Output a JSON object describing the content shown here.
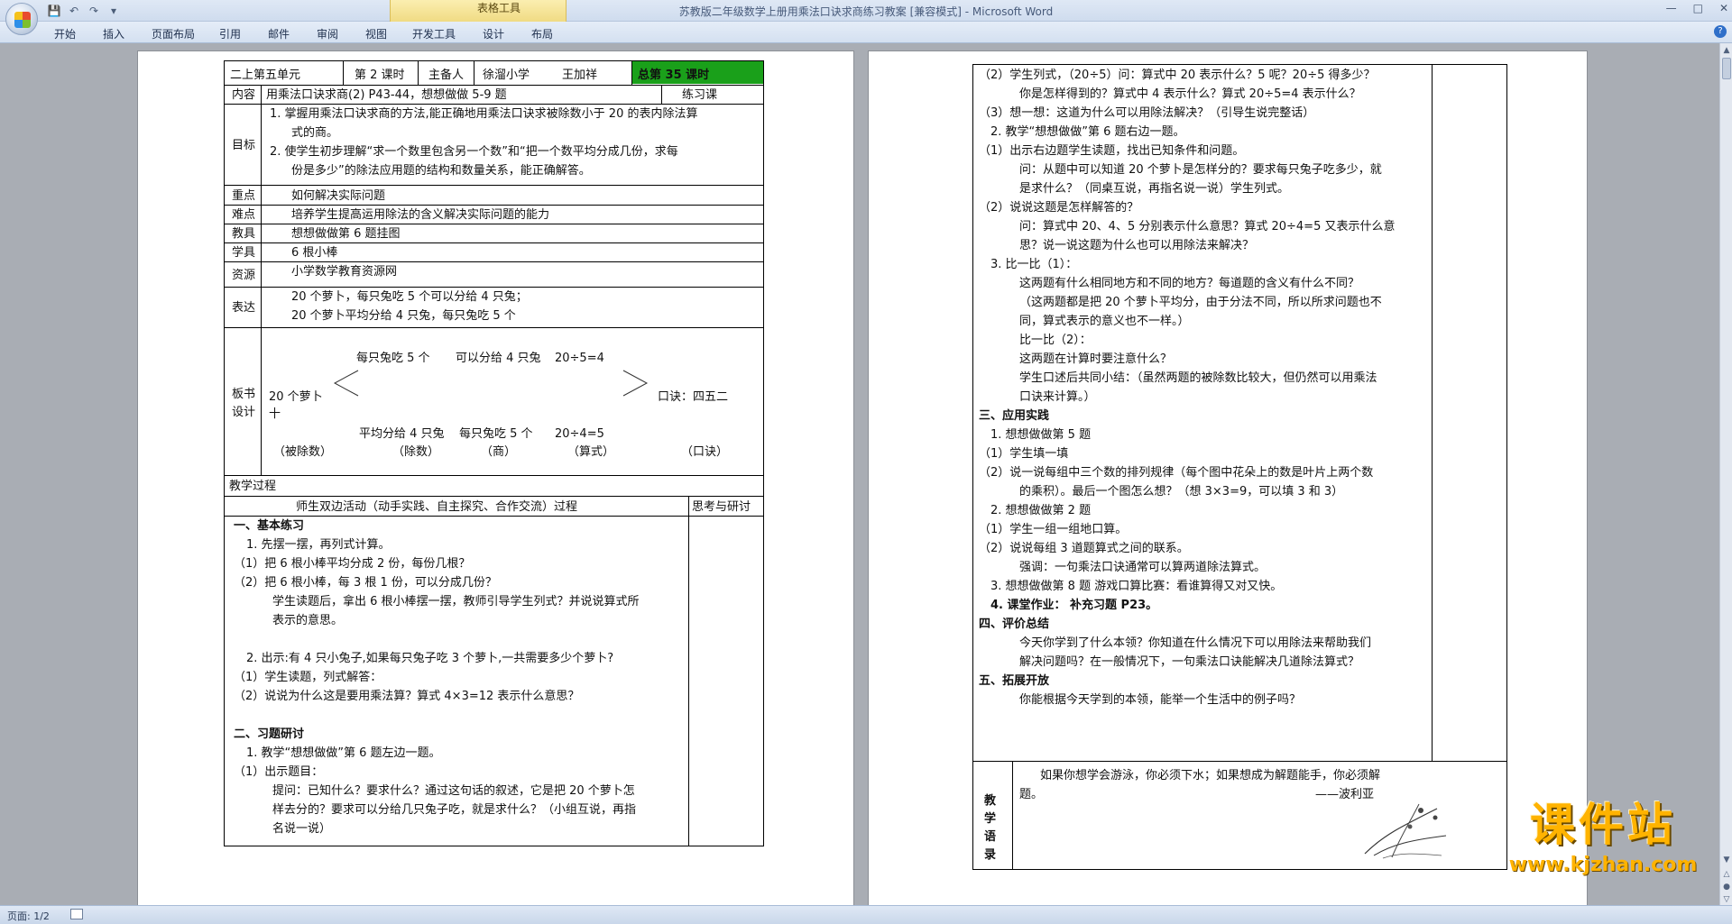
{
  "window": {
    "title": "苏教版二年级数学上册用乘法口诀求商练习教案 [兼容模式] - Microsoft Word",
    "context_tab_group": "表格工具"
  },
  "ribbon_tabs": [
    "开始",
    "插入",
    "页面布局",
    "引用",
    "邮件",
    "审阅",
    "视图",
    "开发工具",
    "设计",
    "布局"
  ],
  "status": {
    "page": "页面: 1/2"
  },
  "page1": {
    "header": {
      "unit": "二上第五单元",
      "lesson": "第 2 课时",
      "preparer_label": "主备人",
      "school": "徐溜小学",
      "teacher": "王加祥",
      "total": "总第 35 课时"
    },
    "row_content": {
      "label": "内容",
      "value": "用乘法口诀求商(2) P43-44，想想做做 5-9 题",
      "type": "练习课"
    },
    "row_goals": {
      "label": "目标",
      "item1a": "1.  掌握用乘法口诀求商的方法,能正确地用乘法口诀求被除数小于 20 的表内除法算",
      "item1b": "式的商。",
      "item2a": "2.  使学生初步理解“求一个数里包含另一个数”和“把一个数平均分成几份，求每",
      "item2b": "份是多少”的除法应用题的结构和数量关系，能正确解答。"
    },
    "row_key": {
      "label": "重点",
      "value": "如何解决实际问题"
    },
    "row_difficult": {
      "label": "难点",
      "value": "培养学生提高运用除法的含义解决实际问题的能力"
    },
    "row_teach_tools": {
      "label": "教具",
      "value": "想想做做第 6 题挂图"
    },
    "row_learn_tools": {
      "label": "学具",
      "value": "6 根小棒"
    },
    "row_resource": {
      "label": "资源",
      "value": "小学数学教育资源网"
    },
    "row_express": {
      "label": "表达",
      "line1": "20 个萝卜，每只兔吃 5 个可以分给 4 只兔；",
      "line2": "20 个萝卜平均分给 4 只兔，每只兔吃 5 个"
    },
    "row_board": {
      "label1": "板书",
      "label2": "设计",
      "top_a": "每只兔吃 5 个",
      "top_b": "可以分给 4 只兔",
      "top_c": "20÷5=4",
      "left": "20 个萝卜",
      "left2": "十",
      "right": "口诀：四五二",
      "bot_a": "平均分给 4 只兔",
      "bot_b": "每只兔吃 5 个",
      "bot_c": "20÷4=5",
      "n1": "（被除数）",
      "n2": "（除数）",
      "n3": "（商）",
      "n4": "（算式）",
      "n5": "（口诀）"
    },
    "process_title": "教学过程",
    "col_activity": "师生双边活动（动手实践、自主探究、合作交流）过程",
    "col_reflect": "思考与研讨",
    "lines": [
      "一、基本练习",
      "1.  先摆一摆，再列式计算。",
      "（1）把 6 根小棒平均分成 2 份，每份几根？",
      "（2）把 6 根小棒，每 3 根 1 份，可以分成几份？",
      "学生读题后，拿出 6 根小棒摆一摆，教师引导学生列式？并说说算式所",
      "表示的意思。",
      "",
      "",
      "2.  出示:有 4 只小兔子,如果每只兔子吃 3 个萝卜,一共需要多少个萝卜?",
      "（1）学生读题，列式解答：",
      "（2）说说为什么这是要用乘法算？算式 4×3=12 表示什么意思？",
      "",
      "二、习题研讨",
      "1.  教学“想想做做”第 6 题左边一题。",
      "（1）出示题目：",
      "提问：已知什么？要求什么？通过这句话的叙述，它是把 20 个萝卜怎",
      "样去分的？要求可以分给几只兔子吃，就是求什么？（小组互说，再指",
      "名说一说）"
    ]
  },
  "page2": {
    "lines": [
      "（2）学生列式，（20÷5）问：算式中 20 表示什么？5 呢？20÷5 得多少？",
      "你是怎样得到的？算式中 4 表示什么？算式 20÷5=4 表示什么？",
      "（3）想一想：这道为什么可以用除法解决？（引导生说完整话）",
      "2.  教学“想想做做”第 6 题右边一题。",
      "（1）出示右边题学生读题，找出已知条件和问题。",
      "问：从题中可以知道 20 个萝卜是怎样分的？要求每只兔子吃多少，就",
      "是求什么？（同桌互说，再指名说一说）学生列式。",
      "（2）说说这题是怎样解答的？",
      "问：算式中 20、4、5 分别表示什么意思？算式 20÷4=5 又表示什么意",
      "思？说一说这题为什么也可以用除法来解决？",
      "3.  比一比（1）：",
      "这两题有什么相同地方和不同的地方？每道题的含义有什么不同？",
      "（这两题都是把 20 个萝卜平均分，由于分法不同，所以所求问题也不",
      "同，算式表示的意义也不一样。）",
      "比一比（2）：",
      "这两题在计算时要注意什么？",
      "学生口述后共同小结：（虽然两题的被除数比较大，但仍然可以用乘法",
      "口诀来计算。）",
      "三、应用实践",
      "1.  想想做做第 5 题",
      "（1）学生填一填",
      "（2）说一说每组中三个数的排列规律（每个图中花朵上的数是叶片上两个数",
      "的乘积）。最后一个图怎么想？（想 3×3=9，可以填 3 和 3）",
      "2.  想想做做第 2 题",
      "（1）学生一组一组地口算。",
      "（2）说说每组 3 道题算式之间的联系。",
      "强调：一句乘法口诀通常可以算两道除法算式。",
      "3.  想想做做第 8 题  游戏口算比赛：看谁算得又对又快。",
      "4.  课堂作业：  补充习题 P23。",
      "四、评价总结",
      "今天你学到了什么本领？你知道在什么情况下可以用除法来帮助我们",
      "解决问题吗？在一般情况下，一句乘法口诀能解决几道除法算式？",
      "五、拓展开放",
      "你能根据今天学到的本领，能举一个生活中的例子吗？"
    ],
    "motto_label": "教学语录",
    "motto1": "如果你想学会游泳，你必须下水；如果想成为解题能手，你必须解",
    "motto2": "题。",
    "motto_author": "——波利亚"
  },
  "watermark": {
    "text": "课件站",
    "url": "www.kjzhan.com"
  }
}
